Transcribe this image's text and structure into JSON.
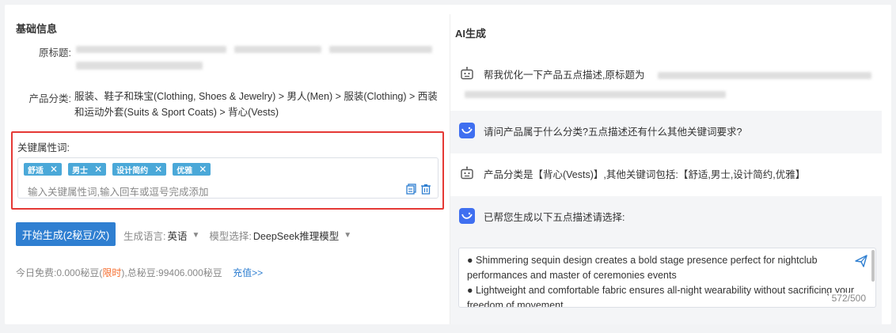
{
  "basic_info": {
    "section_title": "基础信息",
    "original_title_label": "原标题:",
    "category_label": "产品分类:",
    "category_value": "服装、鞋子和珠宝(Clothing, Shoes & Jewelry) > 男人(Men) > 服装(Clothing) > 西装和运动外套(Suits & Sport Coats) > 背心(Vests)"
  },
  "keywords": {
    "label": "关键属性词:",
    "tags": [
      "舒适",
      "男士",
      "设计简约",
      "优雅"
    ],
    "placeholder": "输入关键属性词,输入回车或逗号完成添加",
    "icons": [
      "copy-icon",
      "trash-icon"
    ]
  },
  "generate": {
    "button_label": "开始生成(2秘豆/次)",
    "language_label": "生成语言:",
    "language_value": "英语",
    "model_label": "模型选择:",
    "model_value": "DeepSeek推理模型"
  },
  "balance": {
    "free_prefix": "今日免费:0.000秘豆(",
    "limited": "限时",
    "free_suffix": "),总秘豆:99406.000秘豆",
    "recharge_link": "充值>>"
  },
  "ai": {
    "title": "AI生成",
    "messages": [
      {
        "role": "user",
        "text": "帮我优化一下产品五点描述,原标题为"
      },
      {
        "role": "bot",
        "text": "请问产品属于什么分类?五点描述还有什么其他关键词要求?"
      },
      {
        "role": "user",
        "text": "产品分类是【背心(Vests)】,其他关键词包括:【舒适,男士,设计简约,优雅】"
      },
      {
        "role": "bot",
        "text": "已帮您生成以下五点描述请选择:"
      }
    ],
    "output_lines": [
      "● Shimmering sequin design creates a bold stage presence perfect for nightclub performances and master of ceremonies events",
      "● Lightweight and comfortable fabric ensures all-night wearability without sacrificing your freedom of movement"
    ],
    "counter": "572/500"
  },
  "colors": {
    "accent": "#2f7fd1",
    "tag": "#4aa8d8",
    "highlight_border": "#e53935",
    "limited": "#f56c2d"
  }
}
